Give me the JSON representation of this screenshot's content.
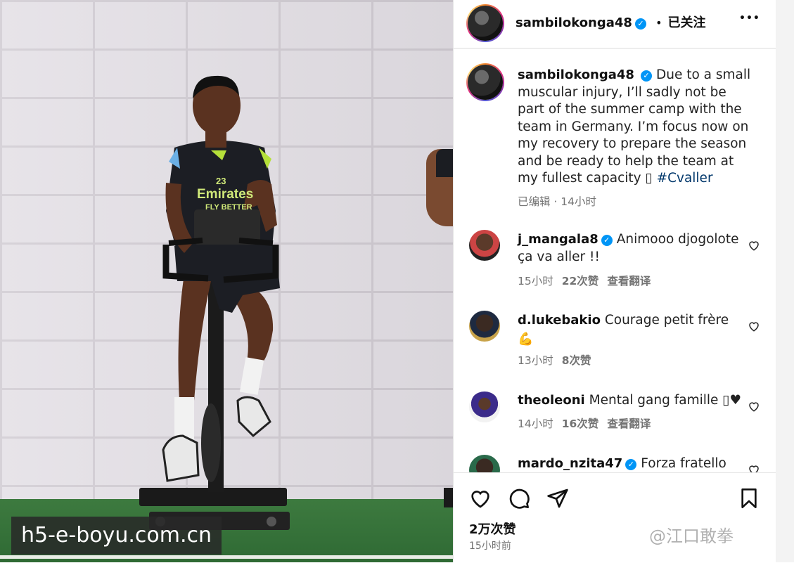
{
  "photo": {
    "watermark": "h5-e-boyu.com.cn",
    "shirt_sponsor": "Emirates",
    "shirt_sponsor_line2": "FLY BETTER",
    "shirt_number": "23"
  },
  "header": {
    "username": "sambilokonga48",
    "separator": "•",
    "follow_status": "已关注",
    "more": "•••"
  },
  "caption": {
    "username": "sambilokonga48",
    "text": "Due to a small muscular injury, I’ll sadly not be part of the summer camp with the team in Germany. I’m focus now on my recovery to prepare the season and be ready to help the team at my fullest capacity ▯ ",
    "hashtag": "#Cvaller",
    "meta": "已编辑 · 14小时"
  },
  "comments": [
    {
      "username": "j_mangala8",
      "verified": true,
      "text": "Animooo djogolote ça va aller !!",
      "time": "15小时",
      "likes": "22次赞",
      "translate": "查看翻译"
    },
    {
      "username": "d.lukebakio",
      "verified": false,
      "text": "Courage petit frère",
      "emoji": "💪",
      "time": "13小时",
      "likes": "8次赞",
      "translate": ""
    },
    {
      "username": "theoleoni",
      "verified": false,
      "text": "Mental gang famille ▯♥",
      "time": "14小时",
      "likes": "16次赞",
      "translate": "查看翻译"
    },
    {
      "username": "mardo_nzita47",
      "verified": true,
      "text": "Forza fratello",
      "time": "",
      "likes": "",
      "translate": ""
    }
  ],
  "actions": {
    "likes": "2万次赞",
    "posted": "15小时前",
    "watermark": "@江口敢拳"
  },
  "colors": {
    "verified": "#0095f6",
    "hashtag": "#00376b",
    "meta": "#737373"
  }
}
